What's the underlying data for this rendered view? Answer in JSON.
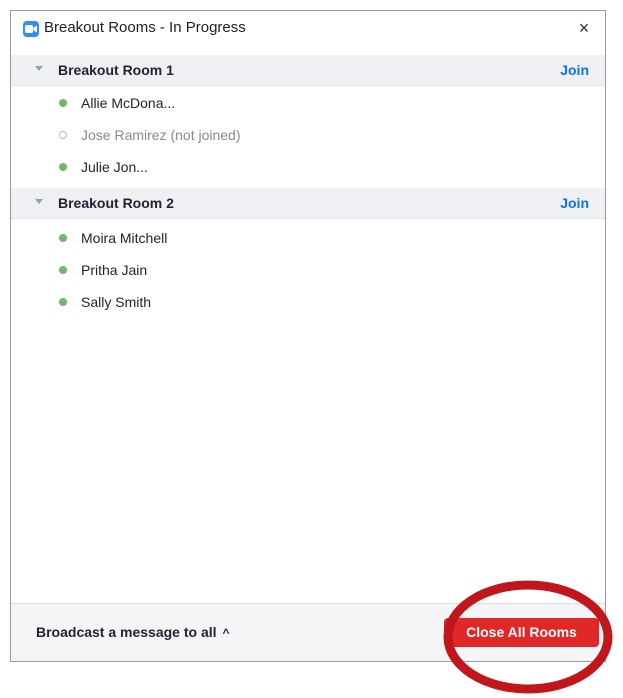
{
  "window": {
    "title": "Breakout Rooms - In Progress",
    "close_label": "×"
  },
  "rooms": [
    {
      "name": "Breakout Room 1",
      "join_label": "Join",
      "participants": [
        {
          "name": "Allie McDona...",
          "joined": true
        },
        {
          "name": "Jose Ramirez (not joined)",
          "joined": false
        },
        {
          "name": "Julie Jon...",
          "joined": true
        }
      ]
    },
    {
      "name": "Breakout Room 2",
      "join_label": "Join",
      "participants": [
        {
          "name": "Moira Mitchell",
          "joined": true
        },
        {
          "name": "Pritha Jain",
          "joined": true
        },
        {
          "name": "Sally Smith",
          "joined": true
        }
      ]
    }
  ],
  "footer": {
    "broadcast_label": "Broadcast a message to all",
    "broadcast_chevron": "^",
    "close_all_label": "Close All Rooms"
  },
  "colors": {
    "accent_blue": "#0e72ed",
    "danger_red": "#e02828",
    "joined_green": "#6db86a",
    "annotation_red": "#c0161c"
  },
  "icons": [
    "video-camera-icon",
    "close-icon",
    "caret-down-icon",
    "status-dot-icon",
    "chevron-up-icon"
  ]
}
